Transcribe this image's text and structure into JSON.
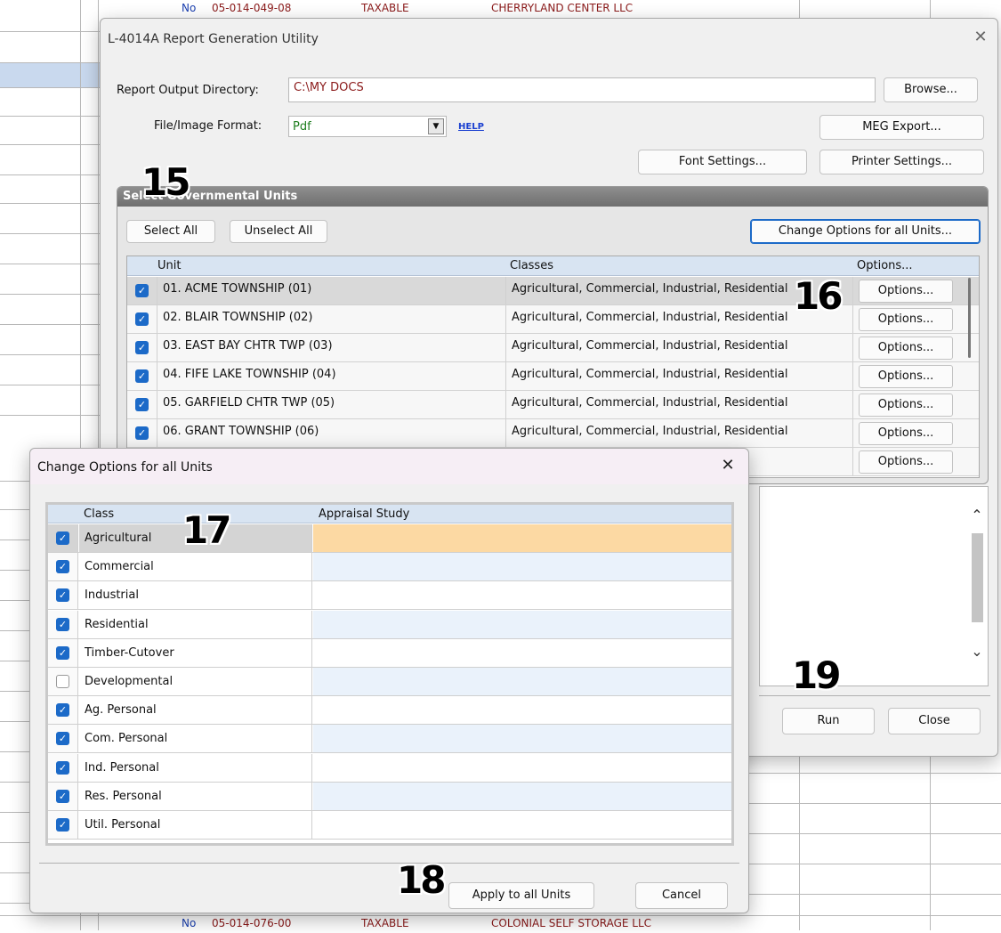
{
  "background": {
    "top_row": {
      "flag": "No",
      "parcel": "05-014-049-08",
      "status": "TAXABLE",
      "owner": "CHERRYLAND CENTER LLC"
    },
    "bottom_row": {
      "flag": "No",
      "parcel": "05-014-076-00",
      "status": "TAXABLE",
      "owner": "COLONIAL SELF STORAGE LLC"
    }
  },
  "main_dialog": {
    "title": "L-4014A Report Generation Utility",
    "output_dir_label": "Report Output Directory:",
    "output_dir_value": "C:\\MY DOCS",
    "browse_label": "Browse...",
    "format_label": "File/Image Format:",
    "format_value": "Pdf",
    "help_label": "HELP",
    "meg_export_label": "MEG Export...",
    "font_settings_label": "Font Settings...",
    "printer_settings_label": "Printer Settings...",
    "group_title": "Select Governmental Units",
    "select_all_label": "Select All",
    "unselect_all_label": "Unselect All",
    "change_options_label": "Change Options for all Units...",
    "columns": {
      "unit": "Unit",
      "classes": "Classes",
      "options": "Options..."
    },
    "units": [
      {
        "unit": "01. ACME TOWNSHIP (01)",
        "classes": "Agricultural, Commercial, Industrial, Residential",
        "options": "Options..."
      },
      {
        "unit": "02. BLAIR TOWNSHIP (02)",
        "classes": "Agricultural, Commercial, Industrial, Residential",
        "options": "Options..."
      },
      {
        "unit": "03. EAST BAY CHTR TWP (03)",
        "classes": "Agricultural, Commercial, Industrial, Residential",
        "options": "Options..."
      },
      {
        "unit": "04. FIFE LAKE TOWNSHIP (04)",
        "classes": "Agricultural, Commercial, Industrial, Residential",
        "options": "Options..."
      },
      {
        "unit": "05. GARFIELD CHTR TWP (05)",
        "classes": "Agricultural, Commercial, Industrial, Residential",
        "options": "Options..."
      },
      {
        "unit": "06. GRANT TOWNSHIP (06)",
        "classes": "Agricultural, Commercial, Industrial, Residential",
        "options": "Options..."
      },
      {
        "unit": "",
        "classes": "",
        "options": "Options..."
      }
    ],
    "run_label": "Run",
    "close_label": "Close"
  },
  "options_dialog": {
    "title": "Change Options for all Units",
    "columns": {
      "class": "Class",
      "appraisal": "Appraisal Study"
    },
    "classes": [
      {
        "name": "Agricultural",
        "checked": true
      },
      {
        "name": "Commercial",
        "checked": true
      },
      {
        "name": "Industrial",
        "checked": true
      },
      {
        "name": "Residential",
        "checked": true
      },
      {
        "name": "Timber-Cutover",
        "checked": true
      },
      {
        "name": "Developmental",
        "checked": false
      },
      {
        "name": "Ag. Personal",
        "checked": true
      },
      {
        "name": "Com. Personal",
        "checked": true
      },
      {
        "name": "Ind. Personal",
        "checked": true
      },
      {
        "name": "Res. Personal",
        "checked": true
      },
      {
        "name": "Util. Personal",
        "checked": true
      }
    ],
    "apply_label": "Apply to all Units",
    "cancel_label": "Cancel"
  },
  "callouts": [
    "15",
    "16",
    "17",
    "18",
    "19"
  ],
  "icons": {
    "close": "close-icon",
    "check": "checkmark-icon",
    "dropdown": "chevron-down-icon",
    "scroll_up": "chevron-up-icon",
    "scroll_down": "chevron-down-icon"
  },
  "colors": {
    "accent": "#1c6ac8",
    "highlight_row": "#fcd9a3",
    "header_bg": "#d8e4f2",
    "alt_row": "#eaf2fb",
    "format_text": "#1e7d1e",
    "dir_text": "#8b1a1a"
  }
}
